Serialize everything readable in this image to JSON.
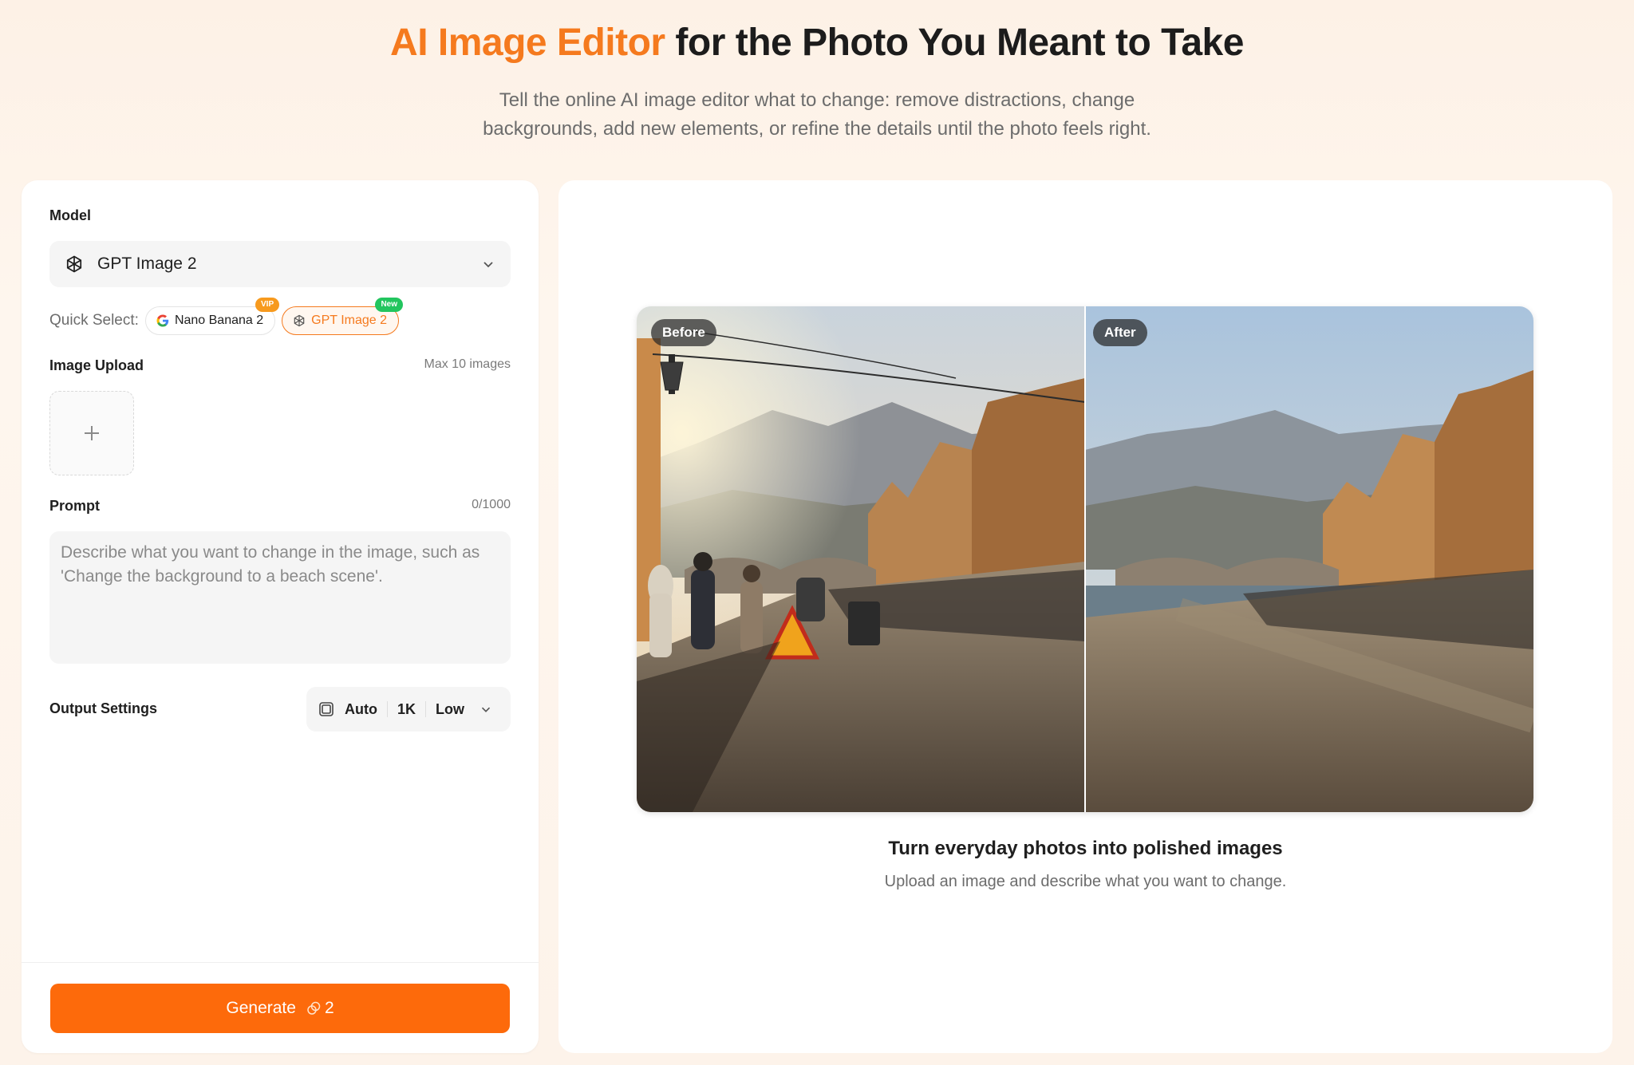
{
  "hero": {
    "title_accent": "AI Image Editor",
    "title_rest": " for the Photo You Meant to Take",
    "subtitle": "Tell the online AI image editor what to change: remove distractions, change backgrounds, add new elements, or refine the details until the photo feels right."
  },
  "editor": {
    "model_label": "Model",
    "model_value": "GPT Image 2",
    "quick_select_label": "Quick Select:",
    "quick_chips": [
      {
        "label": "Nano Banana 2",
        "badge": "VIP"
      },
      {
        "label": "GPT Image 2",
        "badge": "New"
      }
    ],
    "upload_label": "Image Upload",
    "upload_limit": "Max 10 images",
    "prompt_label": "Prompt",
    "prompt_count": "0/1000",
    "prompt_placeholder": "Describe what you want to change in the image, such as 'Change the background to a beach scene'.",
    "output_label": "Output Settings",
    "output_ratio": "Auto",
    "output_resolution": "1K",
    "output_quality": "Low",
    "generate_label": "Generate",
    "generate_cost": "2"
  },
  "preview": {
    "before_label": "Before",
    "after_label": "After",
    "caption_title": "Turn everyday photos into polished images",
    "caption_sub": "Upload an image and describe what you want to change."
  },
  "colors": {
    "accent": "#f57a1e",
    "button": "#fd6a0b",
    "vip": "#f79a1e",
    "new": "#22c55e"
  }
}
